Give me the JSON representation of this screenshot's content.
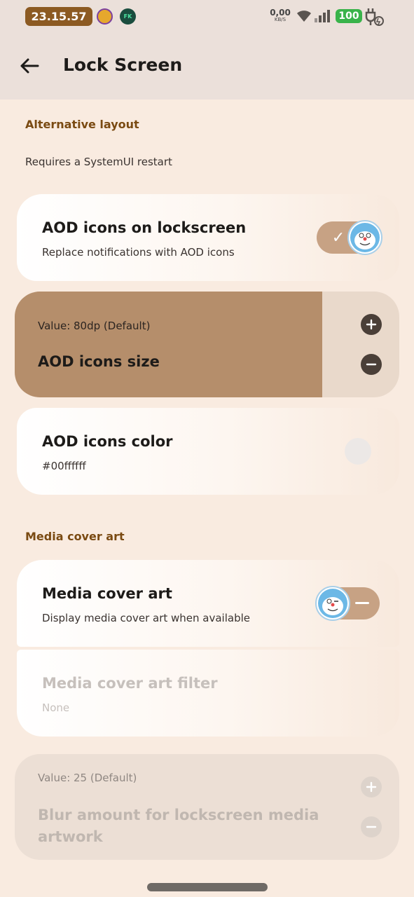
{
  "status_bar": {
    "time": "23.15.57",
    "fk_label": "FK",
    "net_speed_value": "0,00",
    "net_speed_unit": "KB/S",
    "battery": "100"
  },
  "header": {
    "title": "Lock Screen",
    "back_icon": "arrow-left-icon"
  },
  "sections": {
    "alternative_layout": {
      "header": "Alternative layout",
      "note": "Requires a SystemUI restart"
    },
    "media_cover_art": {
      "header": "Media cover art"
    }
  },
  "settings": {
    "aod_icons": {
      "title": "AOD icons on lockscreen",
      "subtitle": "Replace notifications with AOD icons",
      "enabled": true
    },
    "aod_icons_size": {
      "value_label": "Value: 80dp (Default)",
      "title": "AOD icons size",
      "fill_fraction": 0.8
    },
    "aod_icons_color": {
      "title": "AOD icons color",
      "subtitle": "#00ffffff",
      "swatch_color": "#ece8e6"
    },
    "media_cover_art": {
      "title": "Media cover art",
      "subtitle": "Display media cover art when available",
      "enabled": false
    },
    "media_cover_art_filter": {
      "title": "Media cover art filter",
      "subtitle": "None",
      "disabled": true
    },
    "blur_amount": {
      "value_label": "Value: 25 (Default)",
      "title_line1": "Blur amount for lockscreen media",
      "title_line2": "artwork",
      "disabled": true
    }
  },
  "colors": {
    "accent": "#8c5a22",
    "slider_fill": "#b58e6b",
    "toggle_track": "#c7a284",
    "section_header": "#7a4a12",
    "battery_green": "#39b34a"
  }
}
